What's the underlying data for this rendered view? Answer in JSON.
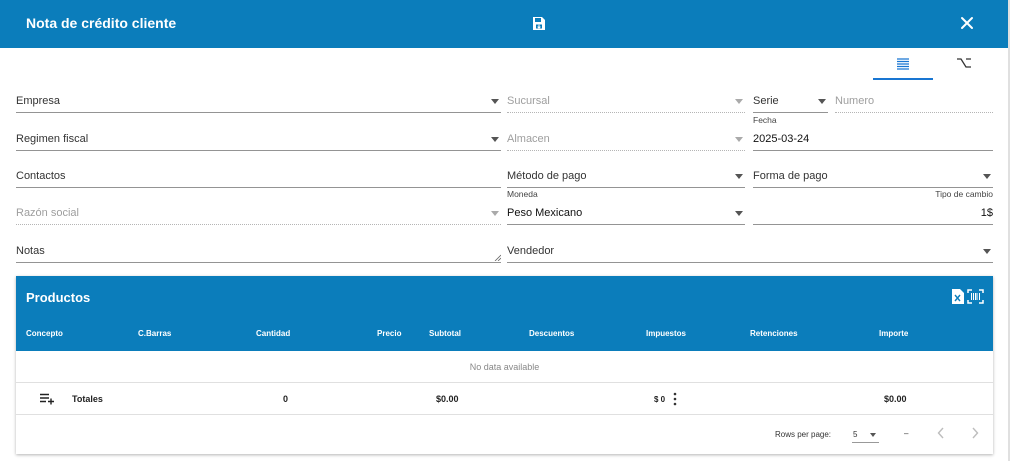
{
  "header": {
    "title": "Nota de crédito cliente",
    "save_icon": "save-icon",
    "close_icon": "close-icon",
    "color": "#0b7dbb"
  },
  "tabs": [
    {
      "icon": "list-icon",
      "active": true
    },
    {
      "icon": "option-key-icon",
      "active": false
    }
  ],
  "form": {
    "empresa": {
      "label": "Empresa"
    },
    "sucursal": {
      "label": "Sucursal"
    },
    "serie": {
      "label": "Serie"
    },
    "numero": {
      "label": "Numero"
    },
    "regimen_fiscal": {
      "label": "Regimen fiscal"
    },
    "almacen": {
      "label": "Almacen"
    },
    "fecha": {
      "label": "Fecha",
      "value": "2025-03-24"
    },
    "contactos": {
      "label": "Contactos"
    },
    "metodo_pago": {
      "label": "Método de pago"
    },
    "forma_pago": {
      "label": "Forma de pago"
    },
    "razon_social": {
      "label": "Razón social"
    },
    "moneda": {
      "label": "Moneda",
      "value": "Peso Mexicano"
    },
    "tipo_cambio": {
      "label": "Tipo de cambio",
      "value": "1$"
    },
    "notas": {
      "label": "Notas"
    },
    "vendedor": {
      "label": "Vendedor"
    }
  },
  "products": {
    "title": "Productos",
    "columns": [
      "Concepto",
      "C.Barras",
      "Cantidad",
      "Precio",
      "Subtotal",
      "Descuentos",
      "Impuestos",
      "Retenciones",
      "Importe"
    ],
    "empty_text": "No data available",
    "totals": {
      "label": "Totales",
      "cantidad": "0",
      "subtotal": "$0.00",
      "impuestos": "$ 0",
      "importe": "$0.00"
    },
    "footer": {
      "rows_per_page_label": "Rows per page:",
      "rows_per_page_value": "5",
      "range": "–"
    }
  }
}
